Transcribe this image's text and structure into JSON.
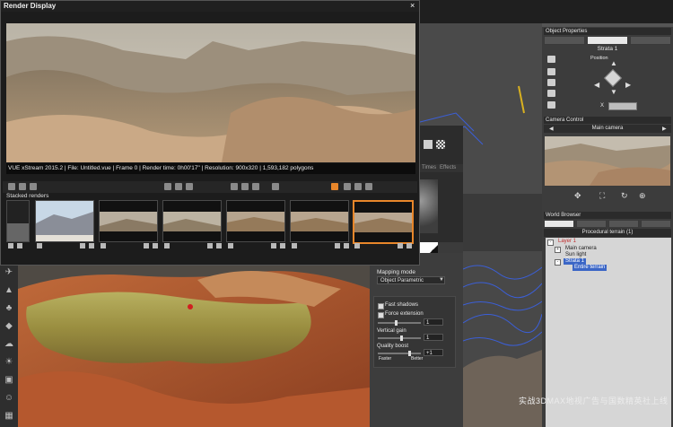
{
  "render_display": {
    "title": "Render Display",
    "close_glyph": "×",
    "status": "VUE xStream 2015.2 | File: Untitled.vue | Frame 0 | Render time: 0h00'17\" | Resolution: 900x320 | 1,593,182 polygons",
    "stacked_label": "Stacked renders",
    "thumbnails_count": 7,
    "selected_thumbnail": 7
  },
  "material": {
    "tab_times": "Times",
    "tab_effects": "Effects",
    "mapping_label": "Mapping mode",
    "mapping_value": "Object Parametric",
    "fast_shadows": "Fast shadows",
    "force_extension": "Force extension",
    "force_extension_value": "1",
    "vertical_gain": "Vertical gain",
    "vertical_gain_value": "1",
    "quality_boost": "Quality boost",
    "faster": "Faster",
    "better": "Better",
    "quality_value": "+1"
  },
  "object_properties": {
    "header": "Object Properties",
    "name": "Strata 1",
    "position_label": "Position",
    "x_label": "X"
  },
  "camera_control": {
    "header": "Camera Control",
    "camera": "Main camera"
  },
  "world_browser": {
    "header": "World Browser",
    "section": "Procedural terrain (1)",
    "items": [
      {
        "label": "Layer 1"
      },
      {
        "label": "Main camera"
      },
      {
        "label": "Sun light"
      },
      {
        "label": "Strata 1"
      },
      {
        "label": "Entire terrain"
      }
    ]
  },
  "watermark": "实战3DMAX地视广告与国数精英社上线",
  "icons": {
    "move": "move-icon",
    "rotate": "rotate-icon",
    "scale": "scale-icon",
    "cube": "cube-icon"
  },
  "colors": {
    "accent": "#e8862a",
    "selection": "#3b66c6",
    "layer_red": "#c03030"
  }
}
